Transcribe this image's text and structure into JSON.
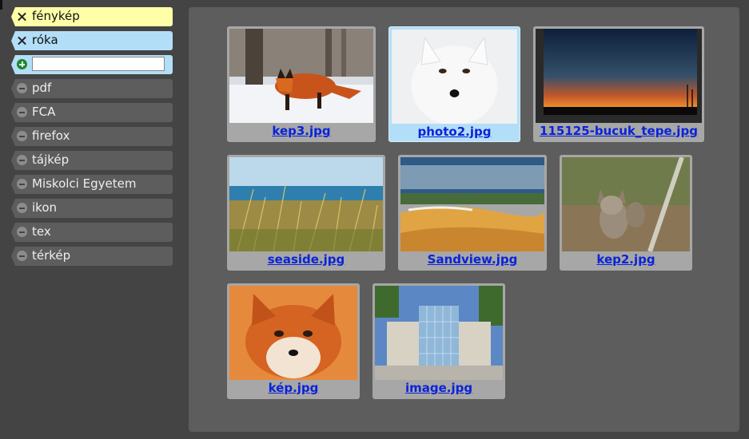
{
  "sidebar": {
    "tags": [
      {
        "label": "fénykép",
        "icon": "remove-x-icon",
        "state": "selected-yellow"
      },
      {
        "label": "róka",
        "icon": "remove-x-icon",
        "state": "selected-blue"
      },
      {
        "label": "pdf",
        "icon": "minus-circle-icon",
        "state": "normal"
      },
      {
        "label": "FCA",
        "icon": "minus-circle-icon",
        "state": "normal"
      },
      {
        "label": "firefox",
        "icon": "minus-circle-icon",
        "state": "normal"
      },
      {
        "label": "tájkép",
        "icon": "minus-circle-icon",
        "state": "normal"
      },
      {
        "label": "Miskolci Egyetem",
        "icon": "minus-circle-icon",
        "state": "normal"
      },
      {
        "label": "ikon",
        "icon": "minus-circle-icon",
        "state": "normal"
      },
      {
        "label": "tex",
        "icon": "minus-circle-icon",
        "state": "normal"
      },
      {
        "label": "térkép",
        "icon": "minus-circle-icon",
        "state": "normal"
      }
    ],
    "add_tag": {
      "icon": "plus-circle-icon",
      "value": "",
      "placeholder": ""
    }
  },
  "gallery": {
    "images": [
      {
        "caption": "kep3.jpg",
        "subject": "red fox in snow",
        "selected": false
      },
      {
        "caption": "photo2.jpg",
        "subject": "white arctic fox",
        "selected": true
      },
      {
        "caption": "115125-bucuk_tepe.jpg",
        "subject": "sunset sky",
        "selected": false
      },
      {
        "caption": "seaside.jpg",
        "subject": "dune grass by the sea",
        "selected": false
      },
      {
        "caption": "Sandview.jpg",
        "subject": "sand dunes",
        "selected": false
      },
      {
        "caption": "kep2.jpg",
        "subject": "fox kits at den",
        "selected": false
      },
      {
        "caption": "kép.jpg",
        "subject": "red fox portrait",
        "selected": false
      },
      {
        "caption": "image.jpg",
        "subject": "glass building",
        "selected": false
      }
    ]
  },
  "colors": {
    "background": "#444444",
    "panel": "#5d5d5d",
    "tag_selected_yellow": "#ffffa8",
    "tag_selected_blue": "#b3def7",
    "link": "#0a23d8"
  }
}
